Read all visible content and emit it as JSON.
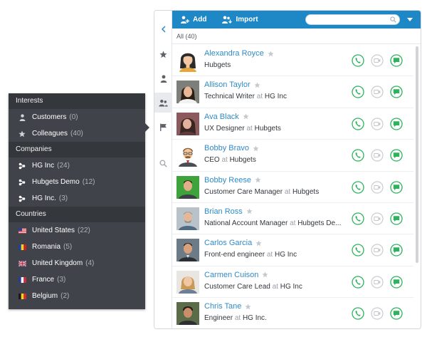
{
  "toolbar": {
    "add_label": "Add",
    "import_label": "Import",
    "search_placeholder": "",
    "color": "#1e87c6"
  },
  "filter_summary": "All (40)",
  "side_nav": [
    {
      "icon": "chevron-left-icon"
    },
    {
      "icon": "star-icon"
    },
    {
      "icon": "person-icon"
    },
    {
      "icon": "people-icon",
      "active": true
    },
    {
      "icon": "flag-icon"
    },
    {
      "icon": "search-icon"
    }
  ],
  "filter_panel": {
    "interests": {
      "header": "Interests",
      "items": [
        {
          "label": "Customers",
          "count": "(0)",
          "icon": "person-icon"
        },
        {
          "label": "Colleagues",
          "count": "(40)",
          "icon": "star-icon"
        }
      ]
    },
    "companies": {
      "header": "Companies",
      "items": [
        {
          "label": "HG Inc",
          "count": "(24)",
          "icon": "company-icon"
        },
        {
          "label": "Hubgets Demo",
          "count": "(12)",
          "icon": "company-icon"
        },
        {
          "label": "HG Inc.",
          "count": "(3)",
          "icon": "company-icon"
        }
      ]
    },
    "countries": {
      "header": "Countries",
      "items": [
        {
          "label": "United States",
          "count": "(22)",
          "icon": "us-flag-icon"
        },
        {
          "label": "Romania",
          "count": "(5)",
          "icon": "romania-flag-icon"
        },
        {
          "label": "United Kingdom",
          "count": "(4)",
          "icon": "uk-flag-icon"
        },
        {
          "label": "France",
          "count": "(3)",
          "icon": "france-flag-icon"
        },
        {
          "label": "Belgium",
          "count": "(2)",
          "icon": "belgium-flag-icon"
        }
      ]
    }
  },
  "contacts": [
    {
      "name": "Alexandra Royce",
      "role": "Hubgets",
      "company": ""
    },
    {
      "name": "Allison Taylor",
      "role": "Technical Writer",
      "company": "HG Inc"
    },
    {
      "name": "Ava Black",
      "role": "UX Designer",
      "company": "Hubgets"
    },
    {
      "name": "Bobby Bravo",
      "role": "CEO",
      "company": "Hubgets"
    },
    {
      "name": "Bobby Reese",
      "role": "Customer Care Manager",
      "company": "Hubgets"
    },
    {
      "name": "Brian Ross",
      "role": "National Account Manager",
      "company": "Hubgets De..."
    },
    {
      "name": "Carlos Garcia",
      "role": "Front-end engineer",
      "company": "HG Inc"
    },
    {
      "name": "Carmen Cuison",
      "role": "Customer Care Lead",
      "company": "HG Inc"
    },
    {
      "name": "Chris Tane",
      "role": "Engineer",
      "company": "HG Inc."
    }
  ],
  "at_word": "at",
  "colors": {
    "accent": "#1e87c6",
    "link": "#2f8bc6",
    "action_green": "#2db35d",
    "panel_bg": "#40444a"
  }
}
